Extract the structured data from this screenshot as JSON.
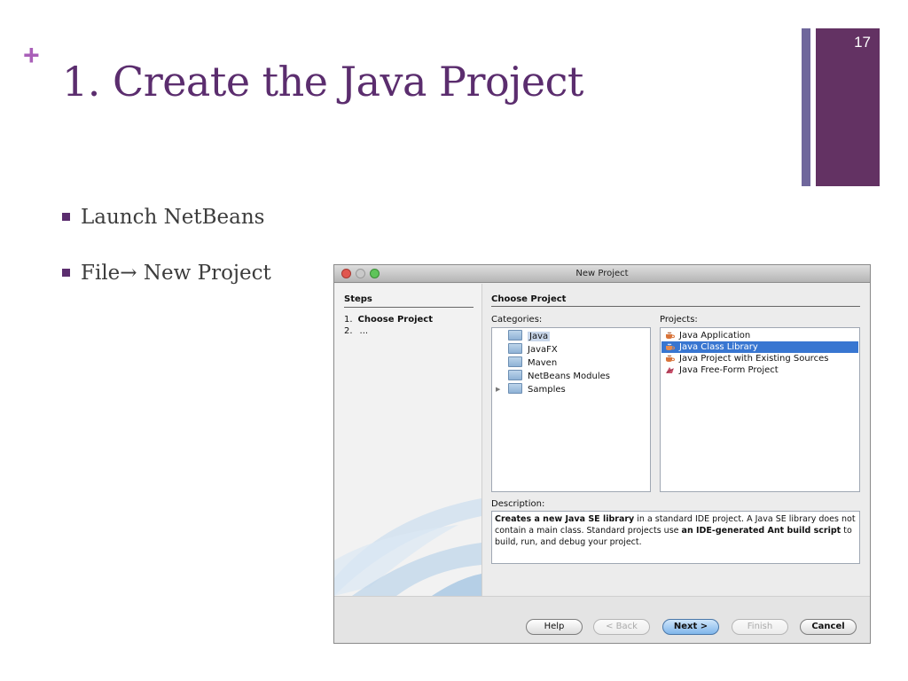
{
  "slide": {
    "plus_marker": "+",
    "title": "1. Create the Java Project",
    "number": "17",
    "bullets": [
      "Launch NetBeans",
      "File→ New Project"
    ],
    "colors": {
      "title": "#5b2d6e",
      "accent_bar": "#633263",
      "thin_bar": "#6f679c",
      "plus": "#a95fb8"
    }
  },
  "dialog": {
    "title": "New Project",
    "steps": {
      "heading": "Steps",
      "step1_num": "1.",
      "step1_label": "Choose Project",
      "step2_num": "2.",
      "step2_label": "..."
    },
    "choose_project": {
      "heading": "Choose Project",
      "categories_label": "Categories:",
      "projects_label": "Projects:",
      "categories": [
        "Java",
        "JavaFX",
        "Maven",
        "NetBeans Modules",
        "Samples"
      ],
      "selected_category": "Java",
      "projects": [
        "Java Application",
        "Java Class Library",
        "Java Project with Existing Sources",
        "Java Free-Form Project"
      ],
      "selected_project": "Java Class Library"
    },
    "description": {
      "label": "Description:",
      "bold1": "Creates a new Java SE library",
      "text1": " in a standard IDE project. A Java SE library does not contain a main class. Standard projects use ",
      "bold2": "an IDE-generated Ant build script",
      "text2": " to build, run, and debug your project."
    },
    "buttons": {
      "help": "Help",
      "back": "< Back",
      "next": "Next >",
      "finish": "Finish",
      "cancel": "Cancel"
    }
  }
}
